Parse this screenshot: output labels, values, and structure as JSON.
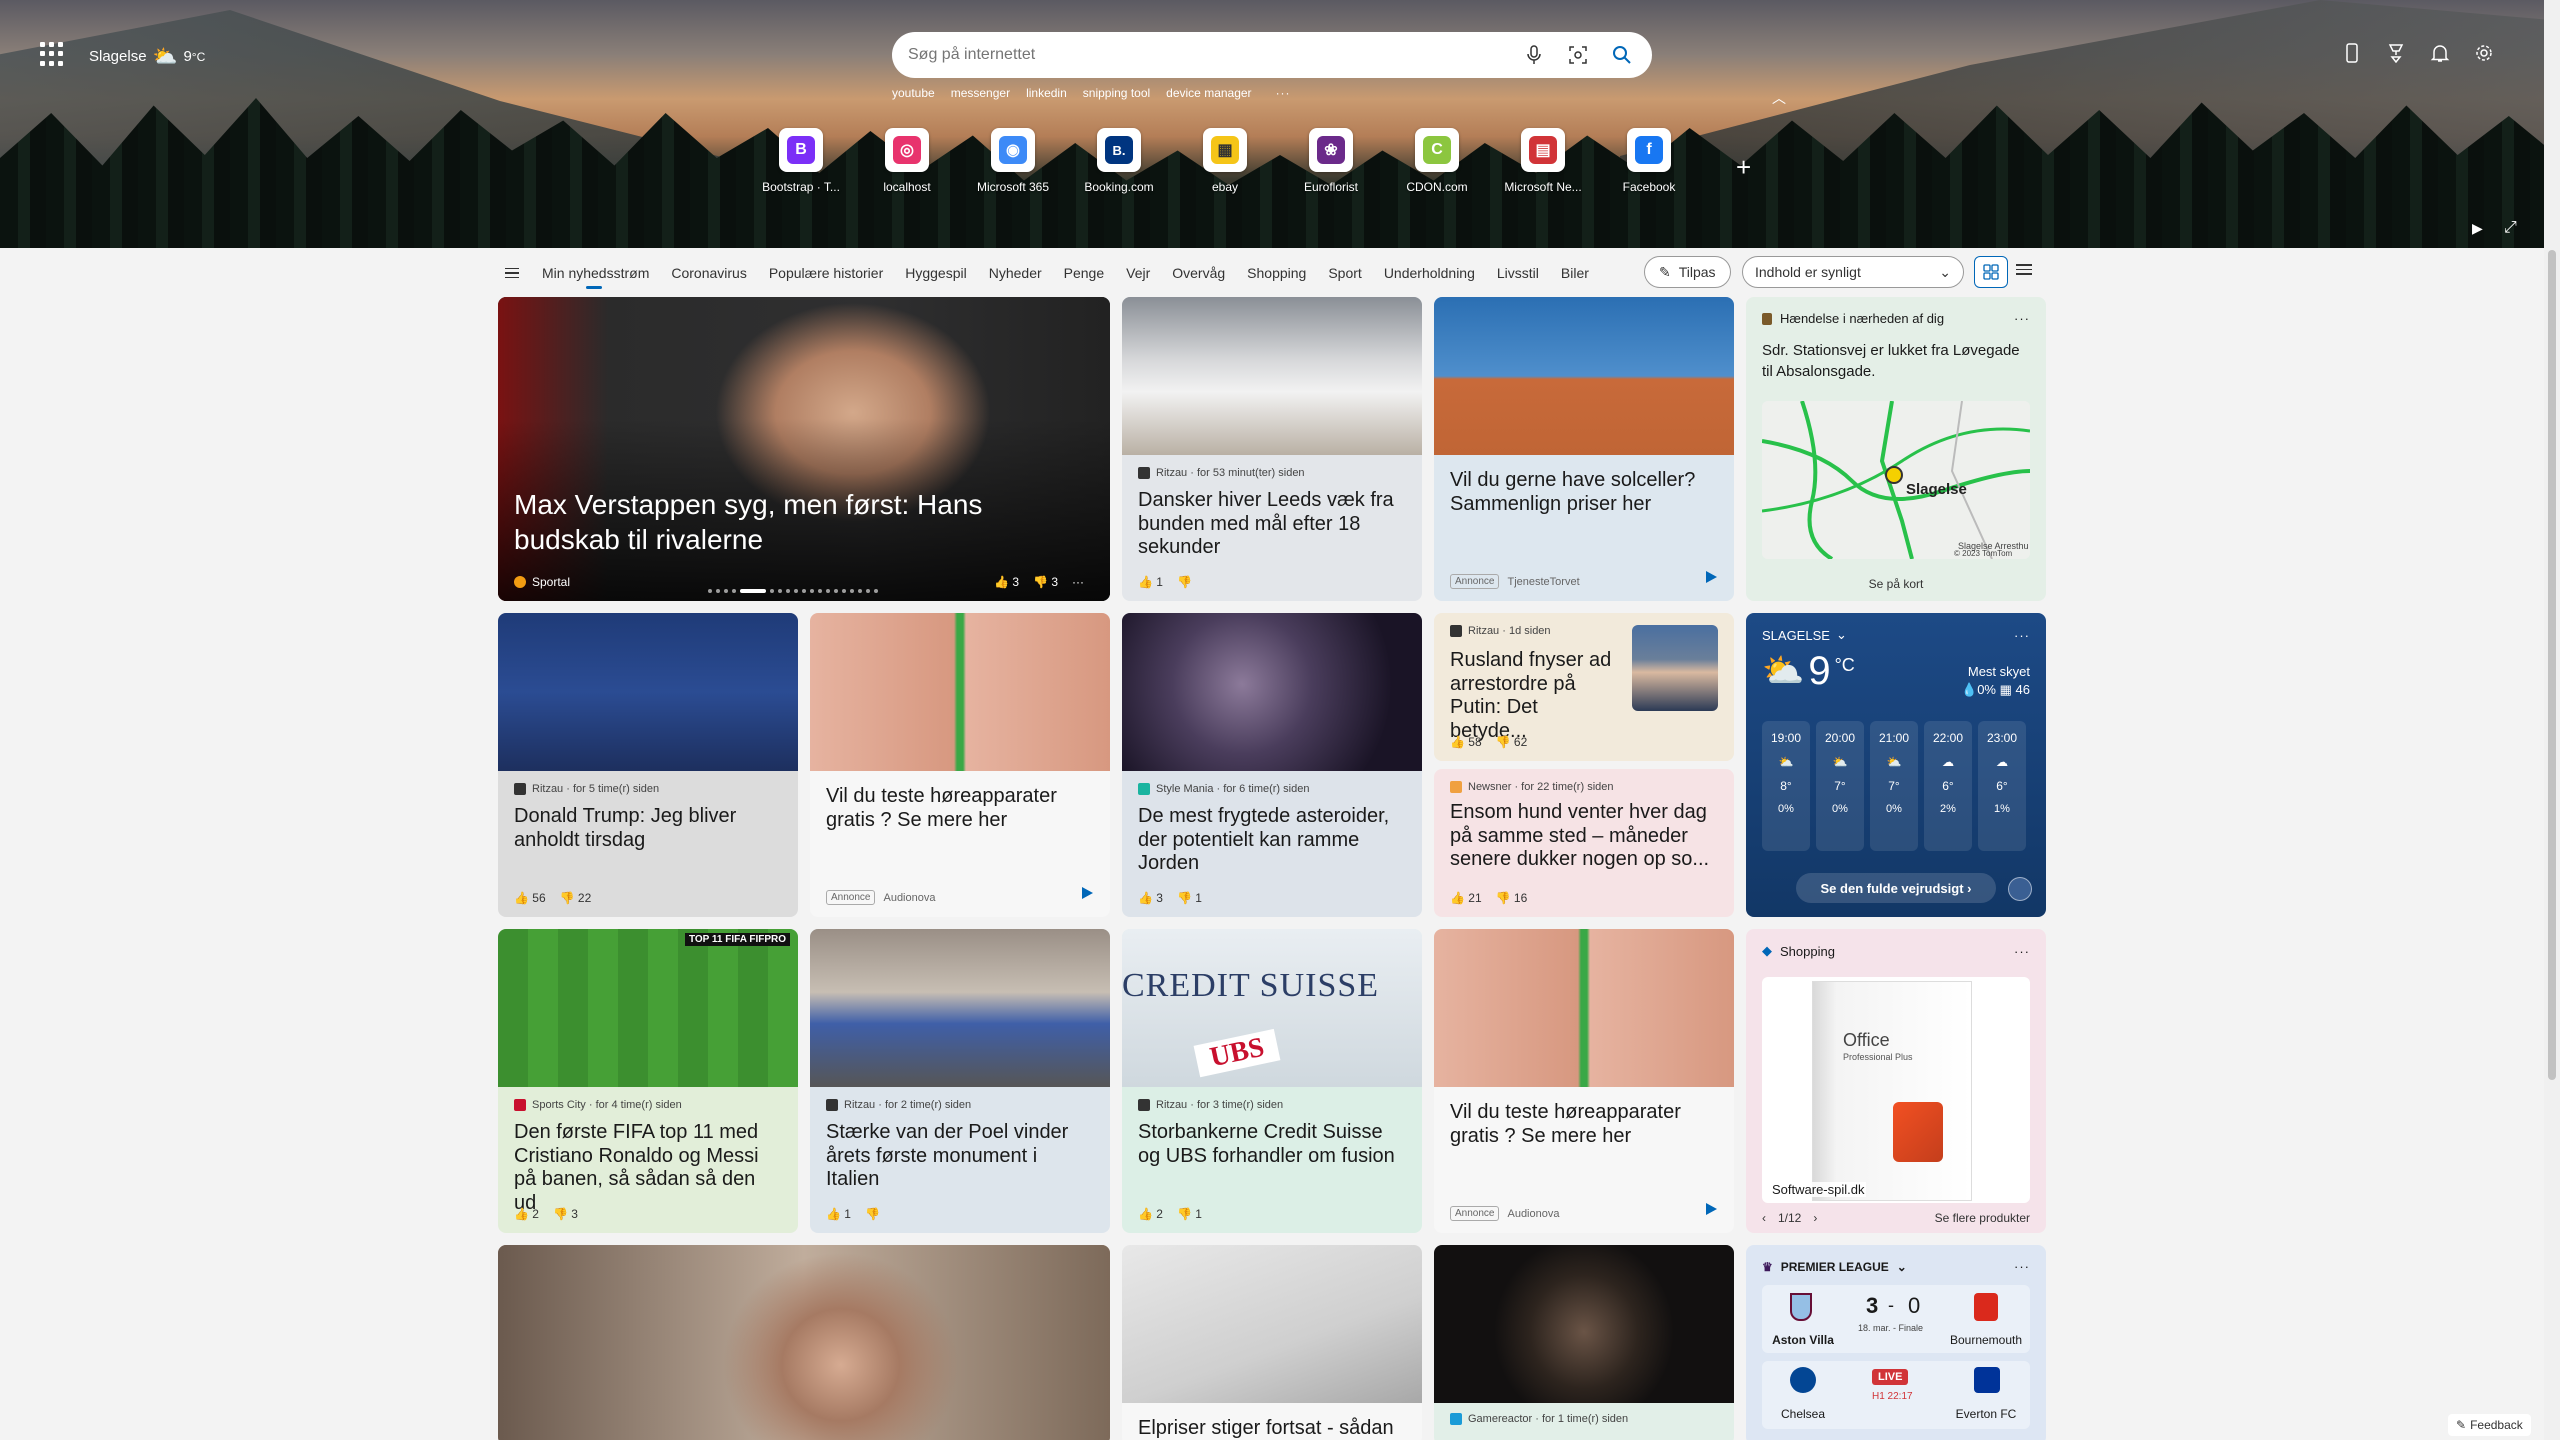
{
  "header": {
    "location": "Slagelse",
    "temp": "9",
    "unit": "°C",
    "search_placeholder": "Søg på internettet",
    "quick_links": [
      "youtube",
      "messenger",
      "linkedin",
      "snipping tool",
      "device manager"
    ],
    "quick_links_more": "···"
  },
  "tiles": [
    {
      "label": "Bootstrap · T...",
      "letter": "B",
      "color": "#7b2ff7"
    },
    {
      "label": "localhost",
      "letter": "◎",
      "color": "#e8336d"
    },
    {
      "label": "Microsoft 365",
      "letter": "◉",
      "color": "#3d8af7"
    },
    {
      "label": "Booking.com",
      "letter": "B.",
      "color": "#003580"
    },
    {
      "label": "ebay",
      "letter": "▦",
      "color": "#f5c518"
    },
    {
      "label": "Euroflorist",
      "letter": "❀",
      "color": "#6b2a8a"
    },
    {
      "label": "CDON.com",
      "letter": "C",
      "color": "#8cc63f"
    },
    {
      "label": "Microsoft Ne...",
      "letter": "▤",
      "color": "#d13438"
    },
    {
      "label": "Facebook",
      "letter": "f",
      "color": "#1877f2"
    }
  ],
  "nav": {
    "tabs": [
      "Min nyhedsstrøm",
      "Coronavirus",
      "Populære historier",
      "Hyggespil",
      "Nyheder",
      "Penge",
      "Vejr",
      "Overvåg",
      "Shopping",
      "Sport",
      "Underholdning",
      "Livsstil",
      "Biler"
    ],
    "tilpas": "Tilpas",
    "visibility": "Indhold er synligt"
  },
  "hero_card": {
    "title": "Max Verstappen syg, men først: Hans budskab til rivalerne",
    "source": "Sportal",
    "likes": "3",
    "dislikes": "3",
    "more": "···"
  },
  "cards": {
    "leeds": {
      "source": "Ritzau · for 53 minut(ter) siden",
      "title": "Dansker hiver Leeds væk fra bunden med mål efter 18 sekunder",
      "likes": "1",
      "dislikes": ""
    },
    "solar": {
      "title": "Vil du gerne have solceller? Sammenlign priser her",
      "annonce": "Annonce",
      "advertiser": "TjenesteTorvet"
    },
    "trump": {
      "source": "Ritzau · for 5 time(r) siden",
      "title": "Donald Trump: Jeg bliver anholdt tirsdag",
      "likes": "56",
      "dislikes": "22"
    },
    "hearing1": {
      "title": "Vil du teste høreapparater gratis ? Se mere her",
      "annonce": "Annonce",
      "advertiser": "Audionova"
    },
    "asteroid": {
      "source": "Style Mania · for 6 time(r) siden",
      "title": "De mest frygtede asteroider, der potentielt kan ramme Jorden",
      "likes": "3",
      "dislikes": "1"
    },
    "putin": {
      "source": "Ritzau · 1d siden",
      "title": "Rusland fnyser ad arrestordre på Putin: Det betyde...",
      "likes": "58",
      "dislikes": "62"
    },
    "dog": {
      "source": "Newsner · for 22 time(r) siden",
      "title": "Ensom hund venter hver dag på samme sted – måneder senere dukker nogen op so...",
      "likes": "21",
      "dislikes": "16"
    },
    "fifa": {
      "source": "Sports City · for 4 time(r) siden",
      "title": "Den første FIFA top 11 med Cristiano Ronaldo og Messi på banen, så sådan så den ud",
      "likes": "2",
      "dislikes": "3",
      "banner": "TOP 11 FIFA FIFPRO"
    },
    "poel": {
      "source": "Ritzau · for 2 time(r) siden",
      "title": "Stærke van der Poel vinder årets første monument i Italien",
      "likes": "1",
      "dislikes": ""
    },
    "cs": {
      "source": "Ritzau · for 3 time(r) siden",
      "title": "Storbankerne Credit Suisse og UBS forhandler om fusion",
      "likes": "2",
      "dislikes": "1",
      "img_text": "CREDIT SUISSE",
      "img_text2": "UBS"
    },
    "hearing2": {
      "title": "Vil du teste høreapparater gratis ? Se mere her",
      "annonce": "Annonce",
      "advertiser": "Audionova"
    },
    "elpris": {
      "title": "Elpriser stiger fortsat - sådan"
    },
    "game": {
      "source": "Gamereactor · for 1 time(r) siden"
    }
  },
  "traffic": {
    "header": "Hændelse i nærheden af dig",
    "text": "Sdr. Stationsvej er lukket fra Løvegade til Absalonsgade.",
    "map_label": "Slagelse",
    "map_small": "Slagelse Arresthu",
    "copyright": "© 2023 TomTom",
    "link": "Se på kort"
  },
  "weather": {
    "location": "SLAGELSE",
    "temp": "9",
    "unit": "°C",
    "condition": "Mest skyet",
    "precip": "0%",
    "humidity": "46",
    "hours": [
      {
        "time": "19:00",
        "temp": "8°",
        "rain": "0%"
      },
      {
        "time": "20:00",
        "temp": "7°",
        "rain": "0%"
      },
      {
        "time": "21:00",
        "temp": "7°",
        "rain": "0%"
      },
      {
        "time": "22:00",
        "temp": "6°",
        "rain": "2%"
      },
      {
        "time": "23:00",
        "temp": "6°",
        "rain": "1%"
      }
    ],
    "button": "Se den fulde vejrudsigt ›"
  },
  "shopping": {
    "header": "Shopping",
    "product_name": "Office",
    "product_sub": "Professional Plus",
    "seller": "Software-spil.dk",
    "page": "1/12",
    "more_link": "Se flere produkter"
  },
  "league": {
    "header": "PREMIER LEAGUE",
    "match1": {
      "home": "Aston Villa",
      "away": "Bournemouth",
      "score_home": "3",
      "score_away": "0",
      "info": "18. mar. - Finale"
    },
    "match2": {
      "home": "Chelsea",
      "away": "Everton FC",
      "status": "LIVE",
      "time": "H1 22:17"
    }
  },
  "feedback": "Feedback",
  "colors": {
    "accent": "#0067b8",
    "weather_bg": "#1d4a86"
  }
}
